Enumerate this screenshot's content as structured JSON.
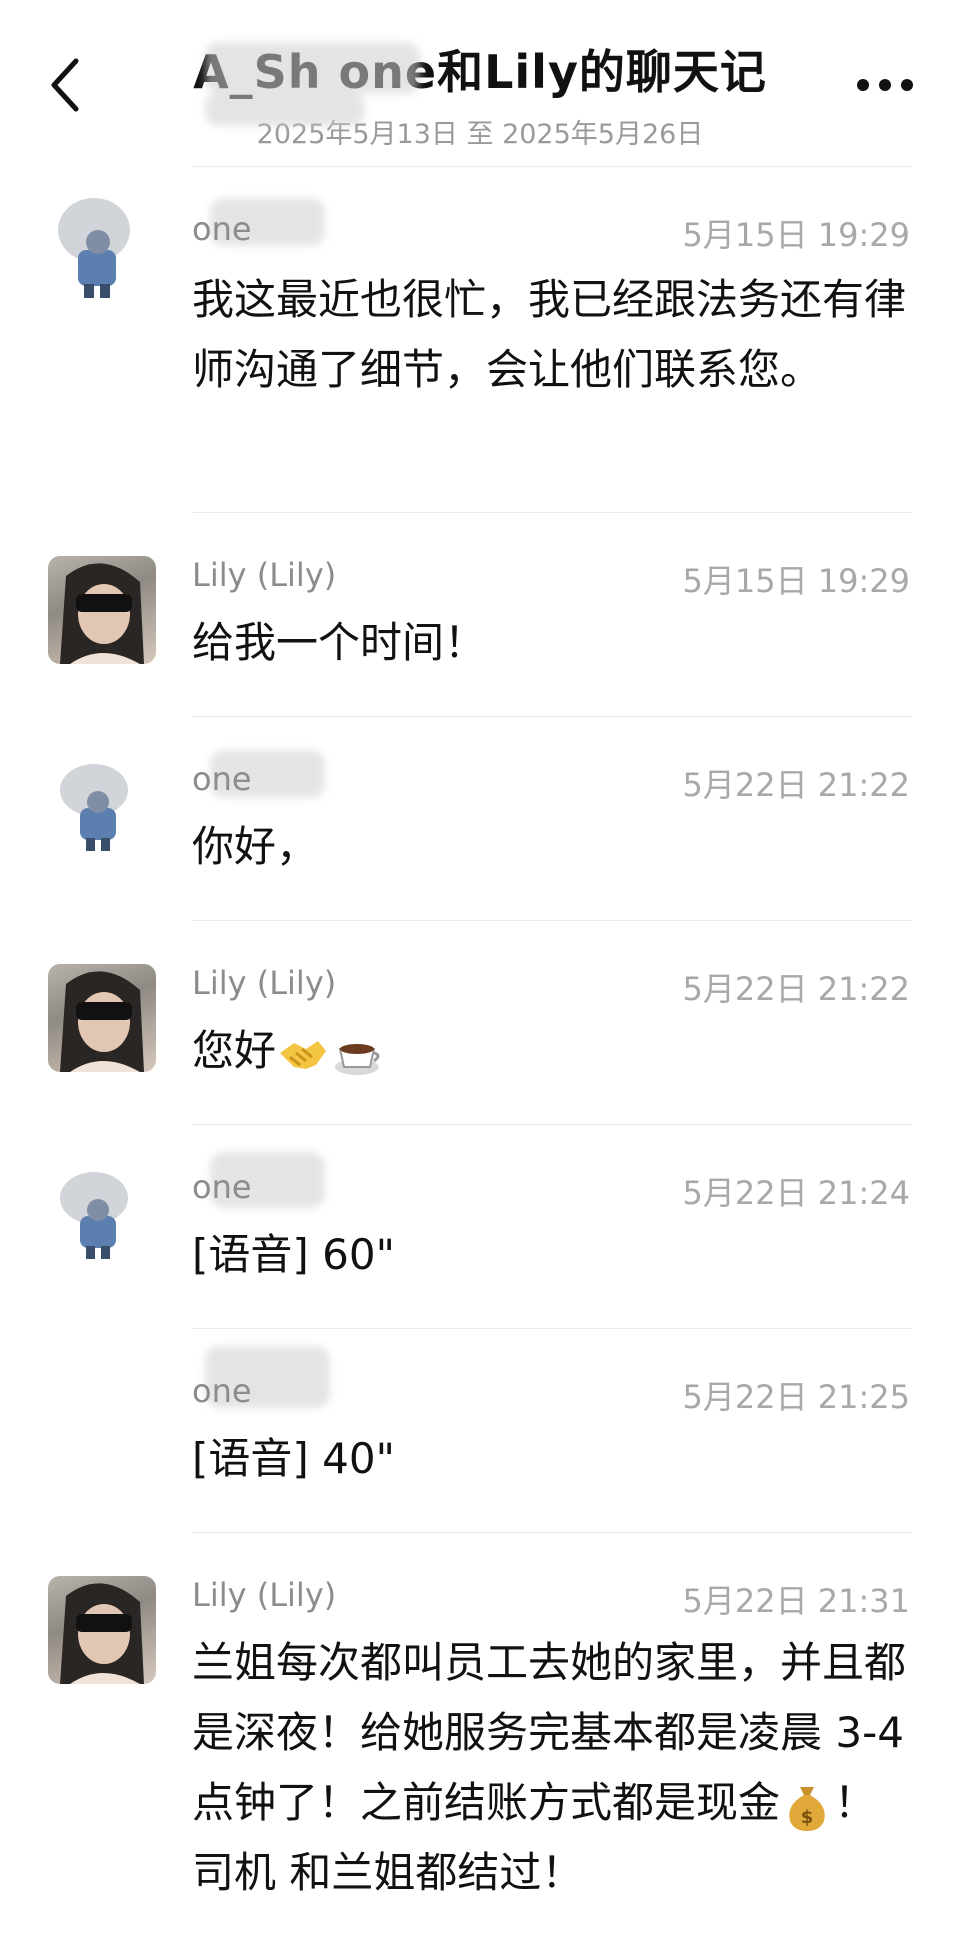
{
  "header": {
    "title": "A_Sh  one和Lily的聊天记",
    "date_range": "2025年5月13日 至 2025年5月26日",
    "back_icon": "chevron-left-icon",
    "more_icon": "more-dots-icon"
  },
  "messages": [
    {
      "sender": "one",
      "time": "5月15日 19:29",
      "text": "我这最近也很忙，我已经跟法务还有律师沟通了细节，会让他们联系您。"
    },
    {
      "sender": "Lily (Lily)",
      "time": "5月15日 19:29",
      "text": "给我一个时间！"
    },
    {
      "sender": "one",
      "time": "5月22日 21:22",
      "text": "你好，"
    },
    {
      "sender": "Lily (Lily)",
      "time": "5月22日 21:22",
      "text": "您好"
    },
    {
      "sender": "one",
      "time": "5月22日 21:24",
      "text": "[语音] 60\""
    },
    {
      "sender": "one",
      "time": "5月22日 21:25",
      "text": "[语音] 40\""
    },
    {
      "sender": "Lily (Lily)",
      "time": "5月22日 21:31",
      "text_a": "兰姐每次都叫员工去她的家里，并且都是深夜！给她服务完基本都是凌晨 3-4 点钟了！之前结账方式都是现金",
      "text_b": "！ 司机 和兰姐都结过！"
    }
  ],
  "icons": {
    "handshake": "handshake-icon",
    "coffee": "coffee-icon",
    "money_bag": "money-bag-icon"
  }
}
